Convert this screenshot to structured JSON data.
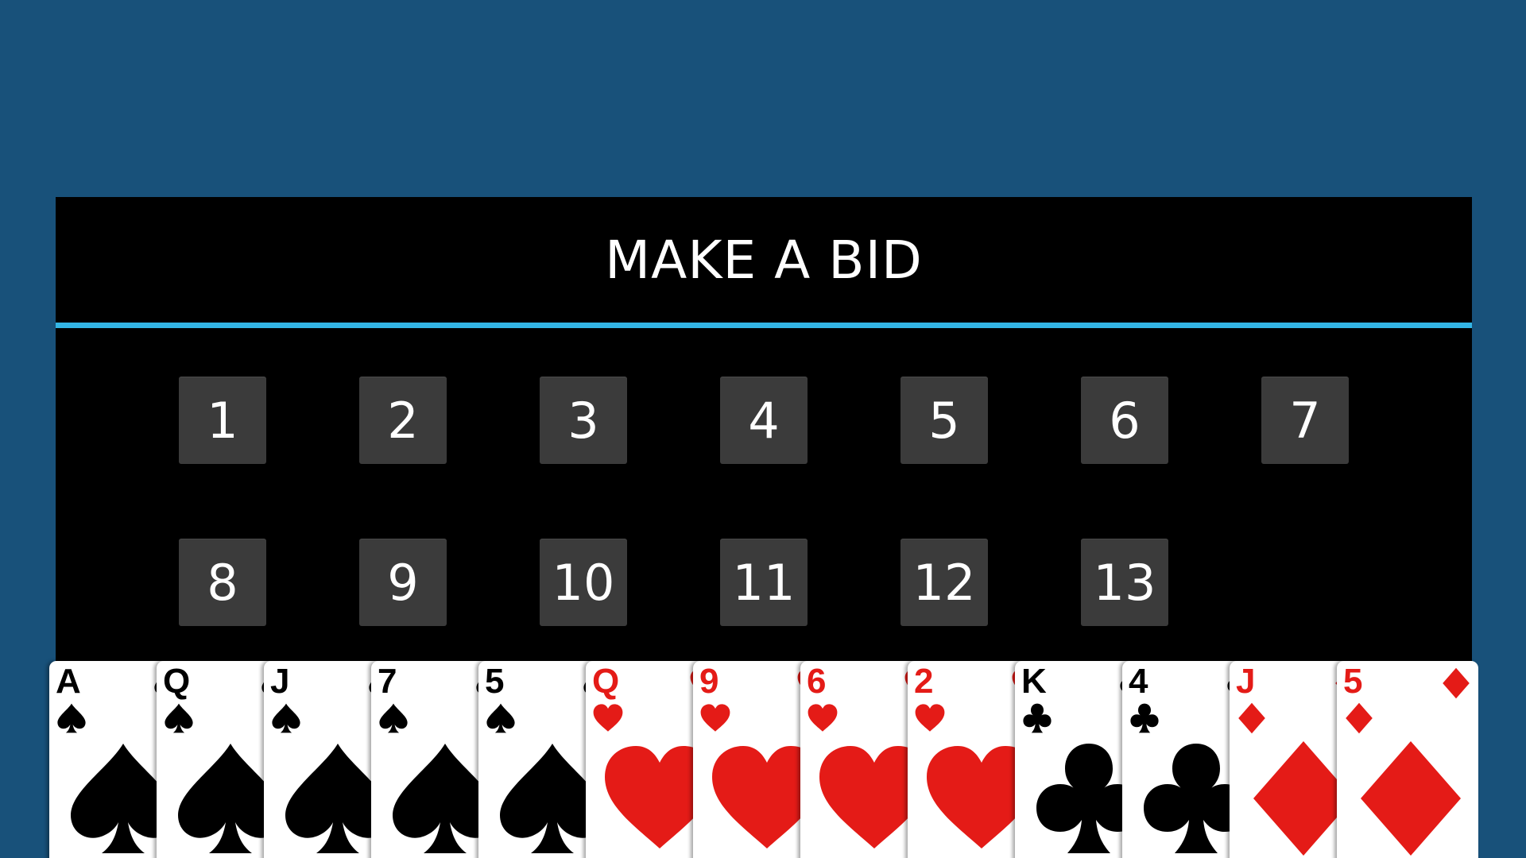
{
  "colors": {
    "background": "#18517a",
    "dialog": "#000000",
    "divider": "#33b5e5",
    "button": "#3b3b3b",
    "button_text": "#ffffff",
    "red_suit": "#e41b17",
    "black_suit": "#000000"
  },
  "bid_dialog": {
    "title": "MAKE A BID",
    "buttons": [
      "1",
      "2",
      "3",
      "4",
      "5",
      "6",
      "7",
      "8",
      "9",
      "10",
      "11",
      "12",
      "13"
    ]
  },
  "hand": {
    "cards": [
      {
        "rank": "A",
        "suit": "spade",
        "color": "black"
      },
      {
        "rank": "Q",
        "suit": "spade",
        "color": "black"
      },
      {
        "rank": "J",
        "suit": "spade",
        "color": "black"
      },
      {
        "rank": "7",
        "suit": "spade",
        "color": "black"
      },
      {
        "rank": "5",
        "suit": "spade",
        "color": "black"
      },
      {
        "rank": "Q",
        "suit": "heart",
        "color": "red"
      },
      {
        "rank": "9",
        "suit": "heart",
        "color": "red"
      },
      {
        "rank": "6",
        "suit": "heart",
        "color": "red"
      },
      {
        "rank": "2",
        "suit": "heart",
        "color": "red"
      },
      {
        "rank": "K",
        "suit": "club",
        "color": "black"
      },
      {
        "rank": "4",
        "suit": "club",
        "color": "black"
      },
      {
        "rank": "J",
        "suit": "diamond",
        "color": "red"
      },
      {
        "rank": "5",
        "suit": "diamond",
        "color": "red"
      }
    ]
  }
}
